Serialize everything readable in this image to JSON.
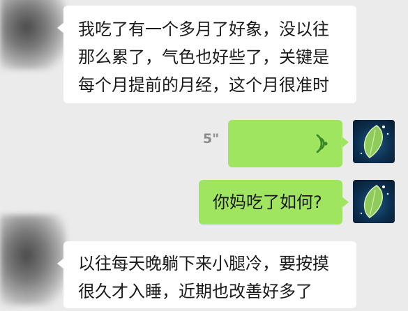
{
  "messages": [
    {
      "side": "in",
      "lines": [
        "我吃了有一个多月了好象，没以往",
        "那么累了，气色也好些了，关键是",
        "每个月提前的月经，这个月很准时"
      ]
    },
    {
      "side": "out",
      "type": "voice",
      "duration": "5\"",
      "icon": "voice-wave-icon"
    },
    {
      "side": "out",
      "lines": [
        "你妈吃了如何?"
      ]
    },
    {
      "side": "in",
      "lines": [
        "以往每天晚躺下来小腿冷，要按摸",
        "很久才入睡，近期也改善好多了"
      ]
    }
  ],
  "colors": {
    "background": "#ebebeb",
    "incoming_bubble": "#ffffff",
    "outgoing_bubble": "#9fe55f",
    "duration_text": "#8a8a8a",
    "voice_icon": "#3c8a2a"
  }
}
